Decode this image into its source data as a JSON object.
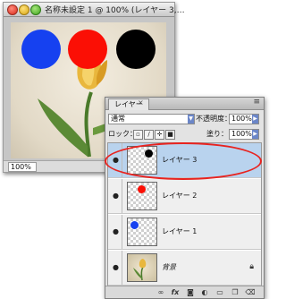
{
  "document": {
    "title": "名称未設定 1 @ 100% (レイヤー 3,…",
    "zoom": "100%",
    "circle_colors": {
      "blue": "#1641f0",
      "red": "#fb0f05",
      "black": "#000000"
    }
  },
  "layers_panel": {
    "tab_label": "レイヤー",
    "close_glyph": "×",
    "menu_glyph": "≡",
    "blend_mode": "通常",
    "opacity_label": "不透明度：",
    "opacity_value": "100%",
    "lock_label": "ロック：",
    "fill_label": "塗り：",
    "fill_value": "100%",
    "lock_icons": [
      "transparency-lock-icon",
      "brush-lock-icon",
      "move-lock-icon",
      "all-lock-icon"
    ],
    "layers": [
      {
        "name": "レイヤー 3",
        "selected": true,
        "thumb_dot": "black"
      },
      {
        "name": "レイヤー 2",
        "selected": false,
        "thumb_dot": "red"
      },
      {
        "name": "レイヤー 1",
        "selected": false,
        "thumb_dot": "blue"
      },
      {
        "name": "背景",
        "selected": false,
        "thumb_dot": "tulip",
        "locked": true
      }
    ],
    "footer_icons": [
      "link-icon",
      "fx-icon",
      "layer-mask-icon",
      "adjustment-layer-icon",
      "group-folder-icon",
      "new-layer-icon",
      "trash-icon"
    ]
  },
  "annotation": {
    "highlight_color": "#e8231f"
  }
}
